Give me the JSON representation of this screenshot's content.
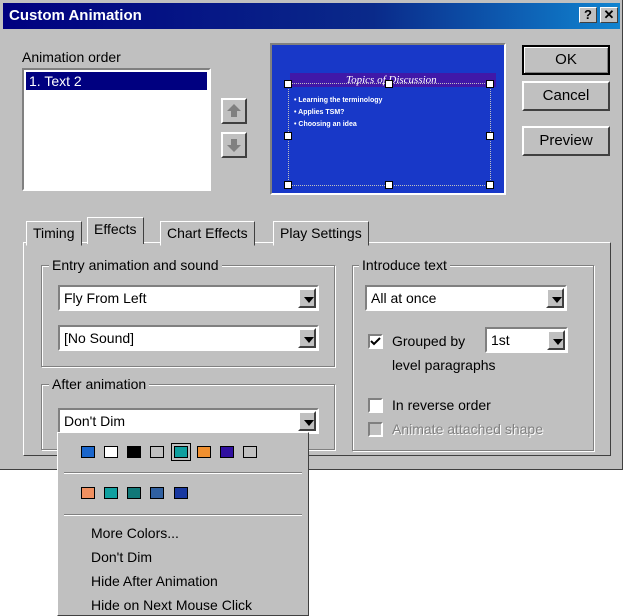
{
  "window": {
    "title": "Custom Animation",
    "help_label": "?",
    "close_label": "✕"
  },
  "animation_order": {
    "label": "Animation order",
    "items": [
      "1. Text 2"
    ]
  },
  "preview": {
    "slide_title": "Topics of Discussion",
    "bullets": [
      "Learning the terminology",
      "Applies TSM?",
      "Choosing an idea"
    ]
  },
  "buttons": {
    "ok": "OK",
    "cancel": "Cancel",
    "preview": "Preview"
  },
  "tabs": [
    "Timing",
    "Effects",
    "Chart Effects",
    "Play Settings"
  ],
  "active_tab": "Effects",
  "entry": {
    "group_label": "Entry animation and sound",
    "effect": "Fly From Left",
    "sound": "[No Sound]"
  },
  "after": {
    "group_label": "After animation",
    "value": "Don't Dim"
  },
  "introduce": {
    "group_label": "Introduce text",
    "value": "All at once",
    "grouped_by_label": "Grouped by",
    "grouped_by_checked": true,
    "level_value": "1st",
    "level_label": "level paragraphs",
    "reverse_label": "In reverse order",
    "reverse_checked": false,
    "attached_label": "Animate attached shape",
    "attached_checked": false
  },
  "colors": {
    "row1": [
      "#1a66cc",
      "#ffffff",
      "#000000",
      "#c0c0c0",
      "#10a0a0",
      "#f09030",
      "#3010a0",
      "#c0c0c0"
    ],
    "row2": [
      "#f09060",
      "#10a0a0",
      "#107878",
      "#3060a0",
      "#1838a0"
    ]
  },
  "dim_menu": {
    "items": [
      "More Colors...",
      "Don't Dim",
      "Hide After Animation",
      "Hide on Next Mouse Click"
    ]
  }
}
